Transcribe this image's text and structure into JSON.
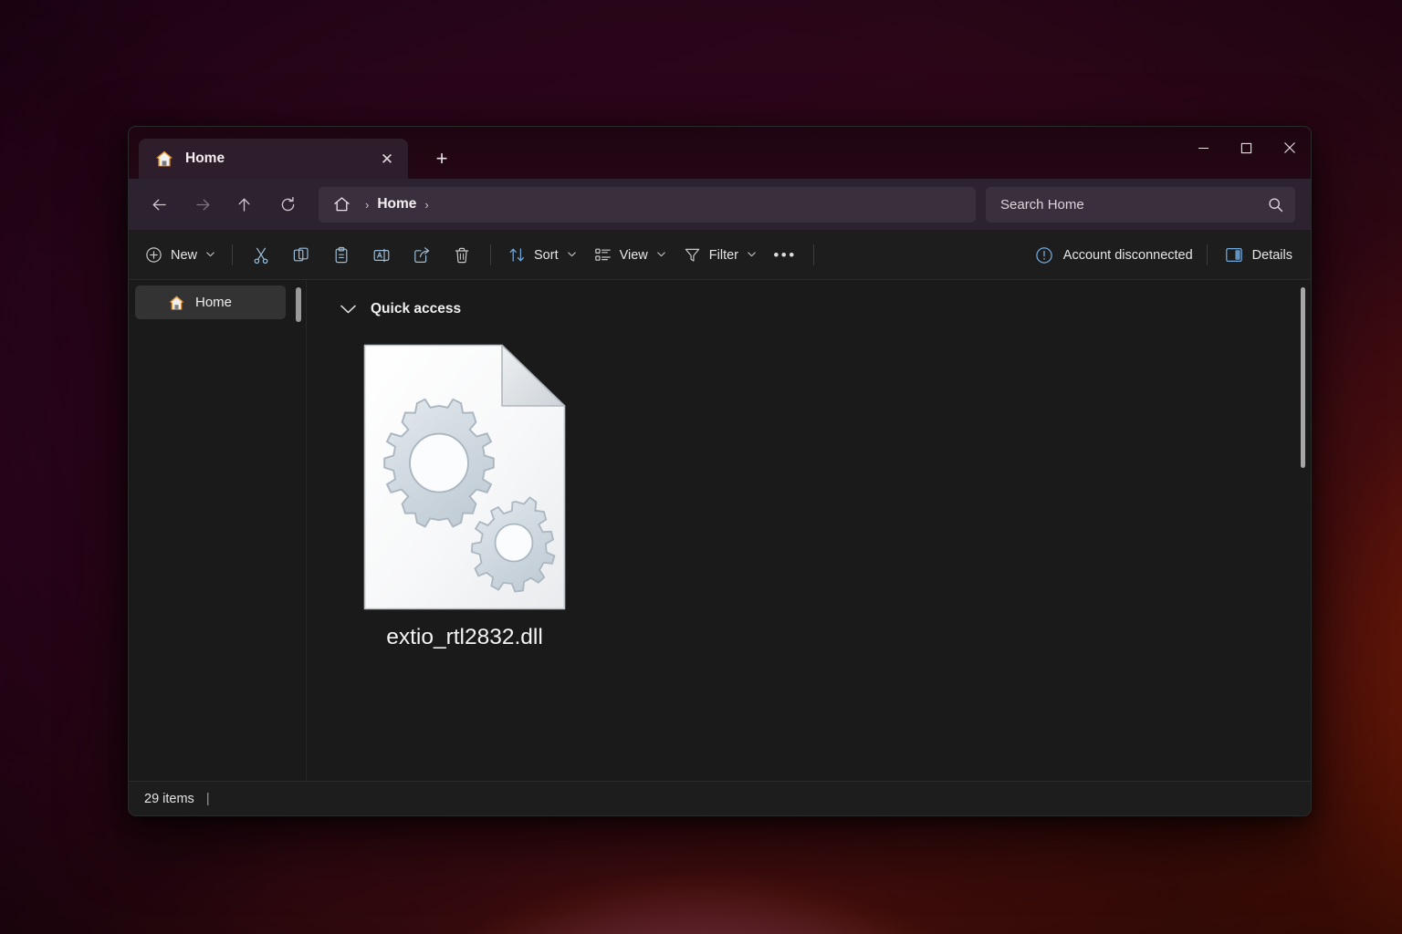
{
  "window": {
    "title": "Home",
    "controls": {
      "minimize": "minimize",
      "maximize": "maximize",
      "close": "close"
    }
  },
  "tabs": {
    "items": [
      {
        "label": "Home",
        "icon": "home-icon",
        "active": true,
        "close_label": "✕"
      }
    ],
    "new_tab_label": "+"
  },
  "navigation": {
    "back": "back-arrow",
    "forward": "forward-arrow",
    "up": "up-arrow",
    "refresh": "refresh-icon"
  },
  "address": {
    "home_icon": "home-outline-icon",
    "separator": "›",
    "crumbs": [
      "Home"
    ],
    "trailing_separator": "›"
  },
  "search": {
    "placeholder": "Search Home",
    "value": "",
    "icon": "search-icon"
  },
  "toolbar": {
    "new_label": "New",
    "new_chevron": "⌄",
    "cut_label": "Cut",
    "copy_label": "Copy",
    "paste_label": "Paste",
    "rename_label": "Rename",
    "share_label": "Share",
    "delete_label": "Delete",
    "sort_label": "Sort",
    "sort_chevron": "⌄",
    "view_label": "View",
    "view_chevron": "⌄",
    "filter_label": "Filter",
    "filter_chevron": "⌄",
    "more_label": "•••",
    "account_label": "Account disconnected",
    "account_icon": "alert-circle-icon",
    "details_label": "Details",
    "details_icon": "details-pane-icon"
  },
  "sidebar": {
    "items": [
      {
        "label": "Home",
        "icon": "home-icon",
        "selected": true
      }
    ]
  },
  "content": {
    "group": {
      "label": "Quick access",
      "expanded": true,
      "chevron": "⌄"
    },
    "files": [
      {
        "name": "extio_rtl2832.dll",
        "icon": "dll-gears-document-icon",
        "selected": false
      }
    ]
  },
  "statusbar": {
    "item_count": "29 items",
    "divider": "|"
  },
  "colors": {
    "titlebar": "#1e0511",
    "tab_active": "#2e1d2a",
    "address_row": "#2d2330",
    "address_field": "#3a2f3d",
    "command_bar": "#1d1d1d",
    "content_bg": "#1a1a1a",
    "sidebar_selected": "#333333",
    "accent_blue": "#6fa8dc",
    "text_primary": "#f0f0f0",
    "home_icon_orange": "#e8902a"
  }
}
